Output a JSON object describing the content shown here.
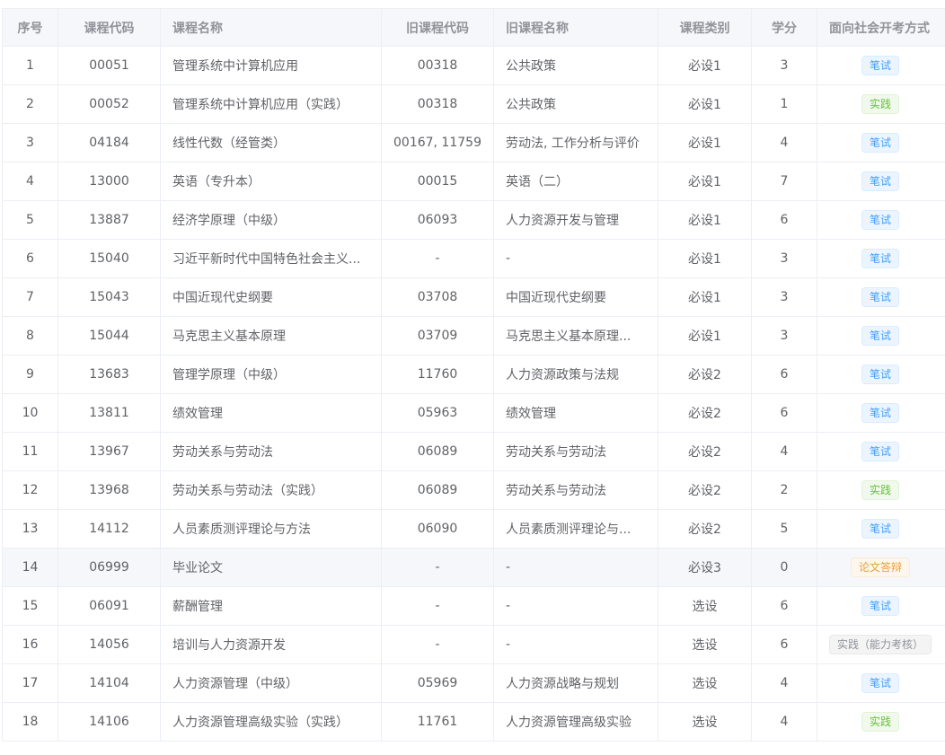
{
  "columns": [
    "序号",
    "课程代码",
    "课程名称",
    "旧课程代码",
    "旧课程名称",
    "课程类别",
    "学分",
    "面向社会开考方式"
  ],
  "tag_colors": {
    "primary": "#409eff",
    "success": "#67c23a",
    "warning": "#e6a23c",
    "info": "#909399"
  },
  "highlight_row": 13,
  "rows": [
    {
      "no": "1",
      "code": "00051",
      "name": "管理系统中计算机应用",
      "old_code": "00318",
      "old_name": "公共政策",
      "category": "必设1",
      "credit": "3",
      "mode": "笔试",
      "tag": "primary"
    },
    {
      "no": "2",
      "code": "00052",
      "name": "管理系统中计算机应用（实践）",
      "old_code": "00318",
      "old_name": "公共政策",
      "category": "必设1",
      "credit": "1",
      "mode": "实践",
      "tag": "success"
    },
    {
      "no": "3",
      "code": "04184",
      "name": "线性代数（经管类）",
      "old_code": "00167, 11759",
      "old_name": "劳动法, 工作分析与评价",
      "category": "必设1",
      "credit": "4",
      "mode": "笔试",
      "tag": "primary"
    },
    {
      "no": "4",
      "code": "13000",
      "name": "英语（专升本）",
      "old_code": "00015",
      "old_name": "英语（二）",
      "category": "必设1",
      "credit": "7",
      "mode": "笔试",
      "tag": "primary"
    },
    {
      "no": "5",
      "code": "13887",
      "name": "经济学原理（中级）",
      "old_code": "06093",
      "old_name": "人力资源开发与管理",
      "category": "必设1",
      "credit": "6",
      "mode": "笔试",
      "tag": "primary"
    },
    {
      "no": "6",
      "code": "15040",
      "name": "习近平新时代中国特色社会主义...",
      "old_code": "-",
      "old_name": "-",
      "category": "必设1",
      "credit": "3",
      "mode": "笔试",
      "tag": "primary"
    },
    {
      "no": "7",
      "code": "15043",
      "name": "中国近现代史纲要",
      "old_code": "03708",
      "old_name": "中国近现代史纲要",
      "category": "必设1",
      "credit": "3",
      "mode": "笔试",
      "tag": "primary"
    },
    {
      "no": "8",
      "code": "15044",
      "name": "马克思主义基本原理",
      "old_code": "03709",
      "old_name": "马克思主义基本原理...",
      "category": "必设1",
      "credit": "3",
      "mode": "笔试",
      "tag": "primary"
    },
    {
      "no": "9",
      "code": "13683",
      "name": "管理学原理（中级）",
      "old_code": "11760",
      "old_name": "人力资源政策与法规",
      "category": "必设2",
      "credit": "6",
      "mode": "笔试",
      "tag": "primary"
    },
    {
      "no": "10",
      "code": "13811",
      "name": "绩效管理",
      "old_code": "05963",
      "old_name": "绩效管理",
      "category": "必设2",
      "credit": "6",
      "mode": "笔试",
      "tag": "primary"
    },
    {
      "no": "11",
      "code": "13967",
      "name": "劳动关系与劳动法",
      "old_code": "06089",
      "old_name": "劳动关系与劳动法",
      "category": "必设2",
      "credit": "4",
      "mode": "笔试",
      "tag": "primary"
    },
    {
      "no": "12",
      "code": "13968",
      "name": "劳动关系与劳动法（实践）",
      "old_code": "06089",
      "old_name": "劳动关系与劳动法",
      "category": "必设2",
      "credit": "2",
      "mode": "实践",
      "tag": "success"
    },
    {
      "no": "13",
      "code": "14112",
      "name": "人员素质测评理论与方法",
      "old_code": "06090",
      "old_name": "人员素质测评理论与...",
      "category": "必设2",
      "credit": "5",
      "mode": "笔试",
      "tag": "primary"
    },
    {
      "no": "14",
      "code": "06999",
      "name": "毕业论文",
      "old_code": "-",
      "old_name": "-",
      "category": "必设3",
      "credit": "0",
      "mode": "论文答辩",
      "tag": "warning"
    },
    {
      "no": "15",
      "code": "06091",
      "name": "薪酬管理",
      "old_code": "-",
      "old_name": "-",
      "category": "选设",
      "credit": "6",
      "mode": "笔试",
      "tag": "primary"
    },
    {
      "no": "16",
      "code": "14056",
      "name": "培训与人力资源开发",
      "old_code": "-",
      "old_name": "-",
      "category": "选设",
      "credit": "6",
      "mode": "实践（能力考核）",
      "tag": "info"
    },
    {
      "no": "17",
      "code": "14104",
      "name": "人力资源管理（中级）",
      "old_code": "05969",
      "old_name": "人力资源战略与规划",
      "category": "选设",
      "credit": "4",
      "mode": "笔试",
      "tag": "primary"
    },
    {
      "no": "18",
      "code": "14106",
      "name": "人力资源管理高级实验（实践）",
      "old_code": "11761",
      "old_name": "人力资源管理高级实验",
      "category": "选设",
      "credit": "4",
      "mode": "实践",
      "tag": "success"
    }
  ]
}
